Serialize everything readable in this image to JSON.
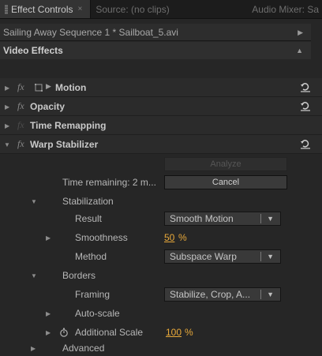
{
  "tabs": [
    {
      "label": "Effect Controls",
      "close": "×"
    },
    {
      "label": "Source: (no clips)"
    },
    {
      "label": "Audio Mixer: Sa"
    }
  ],
  "sequence_label": "Sailing Away Sequence 1 * Sailboat_5.avi",
  "video_effects_label": "Video Effects",
  "fx_symbol": "fx",
  "effects": {
    "motion": "Motion",
    "opacity": "Opacity",
    "time_remapping": "Time Remapping",
    "warp_stabilizer": "Warp Stabilizer"
  },
  "analyze_label": "Analyze",
  "time_remaining": "Time remaining: 2 m...",
  "cancel_label": "Cancel",
  "stabilization": {
    "label": "Stabilization",
    "result_label": "Result",
    "result_value": "Smooth Motion",
    "smoothness_label": "Smoothness",
    "smoothness_value": "50",
    "smoothness_unit": "%",
    "method_label": "Method",
    "method_value": "Subspace Warp"
  },
  "borders": {
    "label": "Borders",
    "framing_label": "Framing",
    "framing_value": "Stabilize, Crop, A...",
    "autoscale_label": "Auto-scale",
    "additional_scale_label": "Additional Scale",
    "additional_scale_value": "100",
    "additional_scale_unit": "%"
  },
  "advanced_label": "Advanced",
  "colors": {
    "accent_value": "#e8a93a",
    "panel_bg": "#262626"
  },
  "icons": [
    "reset-icon",
    "expand-triangle-icon",
    "collapse-triangle-icon",
    "stopwatch-icon",
    "dropdown-arrow-icon",
    "motion-transform-icon"
  ]
}
